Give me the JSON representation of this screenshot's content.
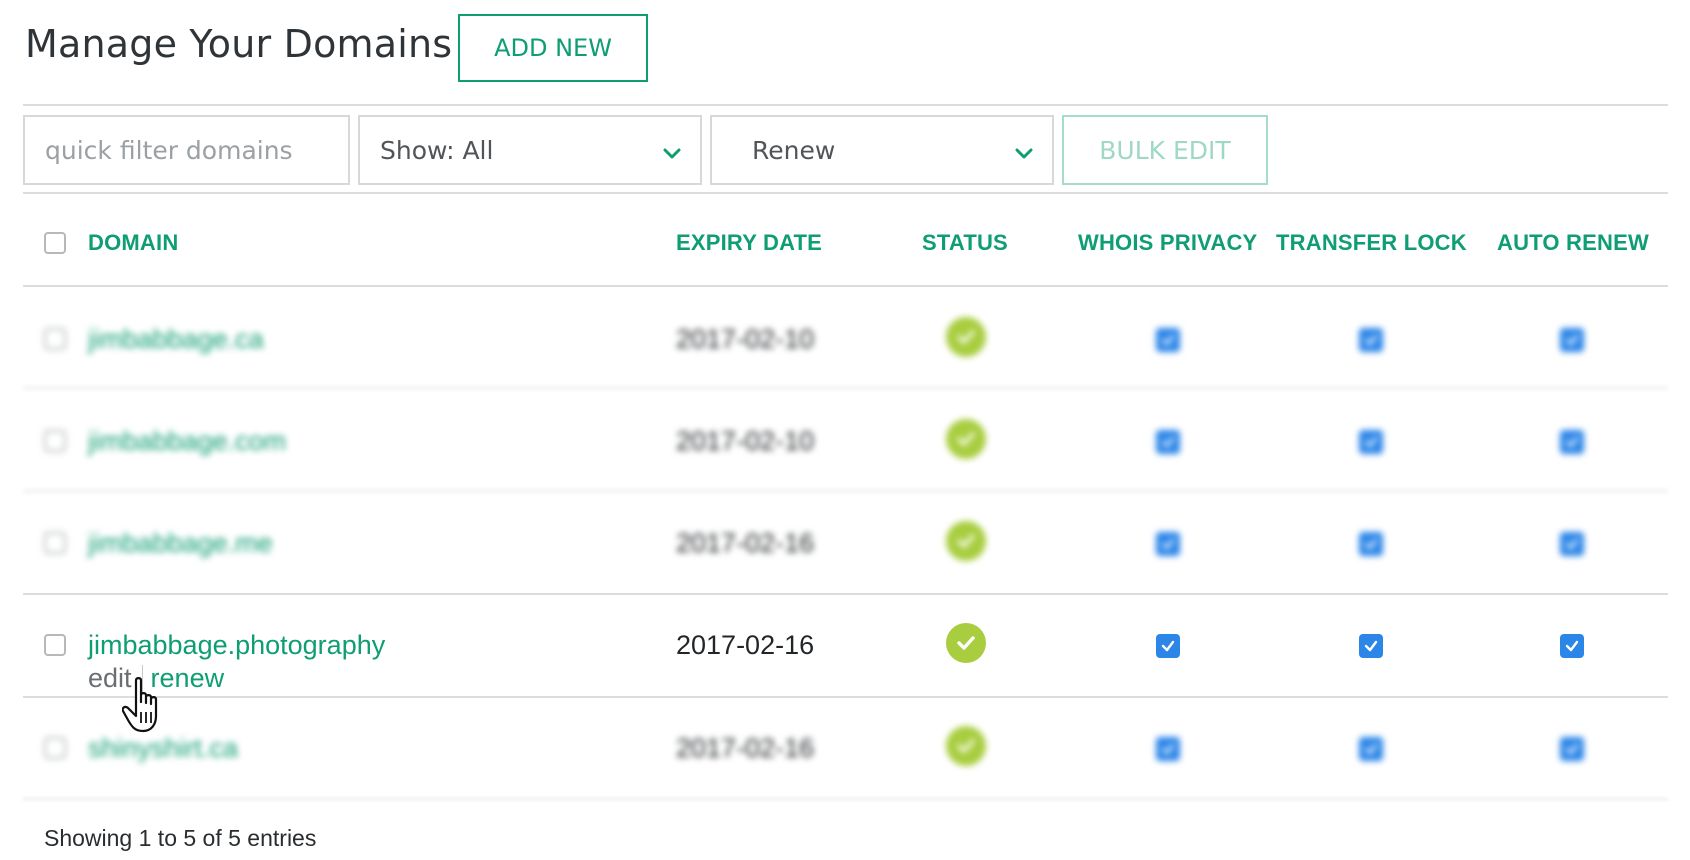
{
  "header": {
    "title": "Manage Your Domains",
    "add_new_label": "ADD NEW"
  },
  "filters": {
    "search_placeholder": "quick filter domains",
    "show_label": "Show: All",
    "action_label": "Renew",
    "bulk_edit_label": "BULK EDIT"
  },
  "table": {
    "columns": {
      "domain": "DOMAIN",
      "expiry": "EXPIRY DATE",
      "status": "STATUS",
      "whois": "WHOIS PRIVACY",
      "transfer_lock": "TRANSFER LOCK",
      "auto_renew": "AUTO RENEW"
    },
    "rows": [
      {
        "domain": "jimbabbage.ca",
        "expiry": "2017-02-10",
        "status": "active",
        "whois": true,
        "transfer_lock": true,
        "auto_renew": true,
        "blurred": true
      },
      {
        "domain": "jimbabbage.com",
        "expiry": "2017-02-10",
        "status": "active",
        "whois": true,
        "transfer_lock": true,
        "auto_renew": true,
        "blurred": true
      },
      {
        "domain": "jimbabbage.me",
        "expiry": "2017-02-16",
        "status": "active",
        "whois": true,
        "transfer_lock": true,
        "auto_renew": true,
        "blurred": true
      },
      {
        "domain": "jimbabbage.photography",
        "expiry": "2017-02-16",
        "status": "active",
        "whois": true,
        "transfer_lock": true,
        "auto_renew": true,
        "blurred": false,
        "actions": {
          "edit": "edit",
          "renew": "renew"
        }
      },
      {
        "domain": "shinyshirt.ca",
        "expiry": "2017-02-16",
        "status": "active",
        "whois": true,
        "transfer_lock": true,
        "auto_renew": true,
        "blurred": true
      }
    ]
  },
  "footer": {
    "entries_text": "Showing 1 to 5 of 5 entries"
  },
  "colors": {
    "accent": "#0f9d73",
    "status_ok": "#a8cd3f",
    "checkbox_checked": "#2c86e8"
  },
  "icons": {
    "status": "check-circle-icon",
    "select": "chevron-down-icon",
    "toggle": "checkbox-checked-icon",
    "pointer": "hand-pointer-icon"
  }
}
